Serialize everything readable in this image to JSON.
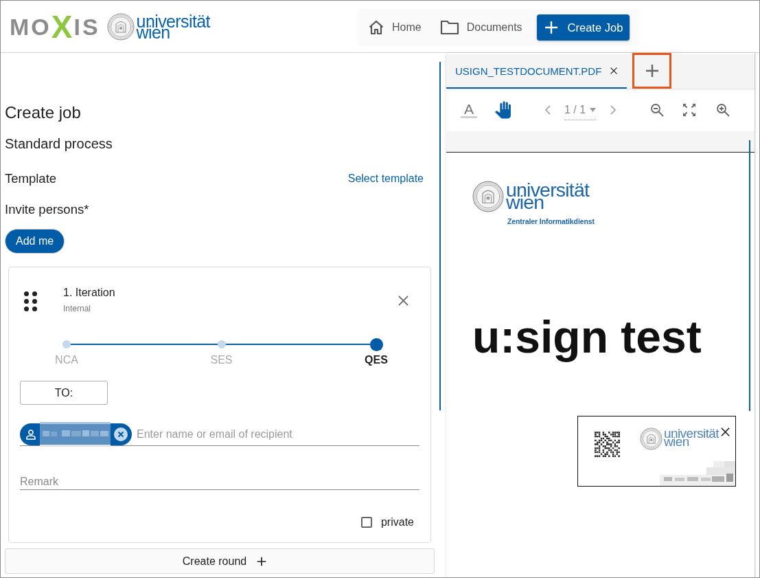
{
  "header": {
    "brand": [
      {
        "text": "MO",
        "accent": false
      },
      {
        "text": "X",
        "accent": true
      },
      {
        "text": "IS",
        "accent": false
      }
    ],
    "university_logo": [
      "universität",
      "wien"
    ],
    "nav": [
      {
        "kind": "home",
        "label": "Home"
      },
      {
        "kind": "documents",
        "label": "Documents"
      },
      {
        "kind": "create",
        "label": "Create Job"
      }
    ]
  },
  "form": {
    "title": "Create job",
    "subtitle": "Standard process",
    "template": {
      "label": "Template",
      "action": "Select template"
    },
    "invite": {
      "label": "Invite persons*",
      "button": "Add me"
    },
    "round": {
      "title": "1. Iteration",
      "type": "Internal",
      "steps": [
        {
          "label": "NCA",
          "selected": false
        },
        {
          "label": "SES",
          "selected": false
        },
        {
          "label": "QES",
          "selected": true
        }
      ],
      "to_button": "TO:",
      "recipients": [
        {
          "kind": "redacted"
        }
      ],
      "recipient_placeholder": "Enter name or email of recipient",
      "remark_placeholder": "Remark",
      "private": {
        "label": "private",
        "checked": false
      }
    },
    "create_round": "Create round"
  },
  "viewer": {
    "tabs": [
      {
        "label": "USIGN_TESTDOCUMENT.PDF",
        "selected": true
      }
    ],
    "add_tab": {
      "highlighted": true
    },
    "tools": [
      {
        "kind": "text",
        "glyph": "A",
        "selected": false
      },
      {
        "kind": "pan",
        "selected": true
      }
    ],
    "page_indicator": "1 / 1",
    "document": {
      "logo": [
        "universität",
        "wien"
      ],
      "department": "Zentraler Informatikdienst",
      "heading": "u:sign test",
      "signature": {
        "logo": [
          "universität",
          "wien"
        ]
      }
    }
  }
}
